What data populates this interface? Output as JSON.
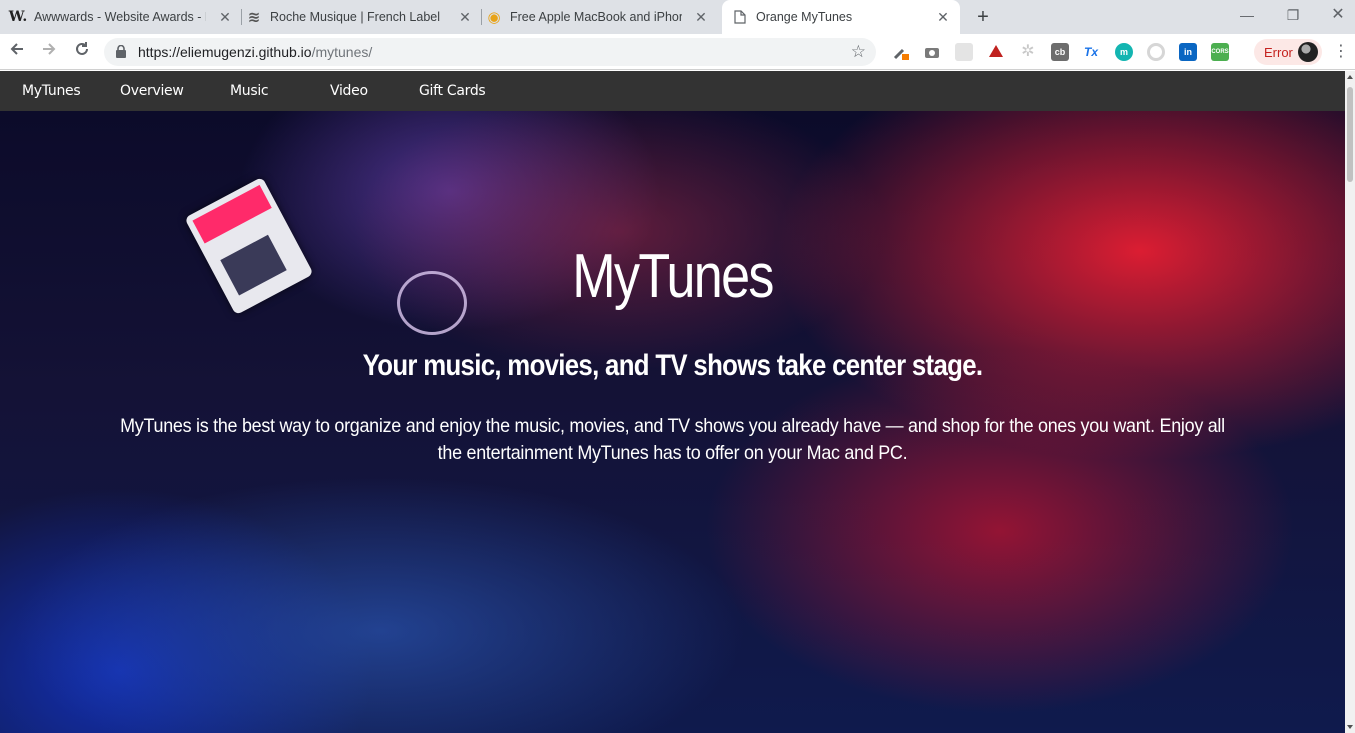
{
  "browser": {
    "tabs": [
      {
        "title": "Awwwards - Website Awards - Be",
        "favicon": "W.",
        "active": false
      },
      {
        "title": "Roche Musique | French Label | A",
        "favicon": "waves-icon",
        "active": false
      },
      {
        "title": "Free Apple MacBook and iPhone",
        "favicon": "coin-stack-icon",
        "active": false
      },
      {
        "title": "Orange MyTunes",
        "favicon": "document-icon",
        "active": true
      }
    ],
    "url_host": "https://eliemugenzi.github.io",
    "url_path": "/mytunes/",
    "error_label": "Error",
    "extensions": [
      {
        "name": "eyedropper-extension-icon",
        "color": "#5f6368"
      },
      {
        "name": "camera-extension-icon",
        "color": "#7a7a7a"
      },
      {
        "name": "grid-extension-icon",
        "color": "#d0d0d0"
      },
      {
        "name": "ruby-extension-icon",
        "color": "#c0221f"
      },
      {
        "name": "gear-extension-icon",
        "color": "#c8c8c8"
      },
      {
        "name": "cb-extension-icon",
        "label": "cb",
        "color": "#6d6d6d"
      },
      {
        "name": "tx-extension-icon",
        "label": "Tx",
        "color": "#ffffff"
      },
      {
        "name": "m-extension-icon",
        "label": "m",
        "color": "#13b5b1"
      },
      {
        "name": "circle-extension-icon",
        "color": "#d6d6d6"
      },
      {
        "name": "linkedin-extension-icon",
        "label": "in",
        "color": "#0a66c2"
      },
      {
        "name": "cors-extension-icon",
        "label": "CORS",
        "color": "#4caf50"
      }
    ]
  },
  "site": {
    "nav": [
      "MyTunes",
      "Overview",
      "Music",
      "Video",
      "Gift Cards"
    ],
    "hero": {
      "title": "MyTunes",
      "subtitle": "Your music, movies, and TV shows take center stage.",
      "body": "MyTunes is the best way to organize and enjoy the music, movies, and TV shows you already have — and shop for the ones you want. Enjoy all the entertainment MyTunes has to offer on your Mac and PC."
    }
  }
}
